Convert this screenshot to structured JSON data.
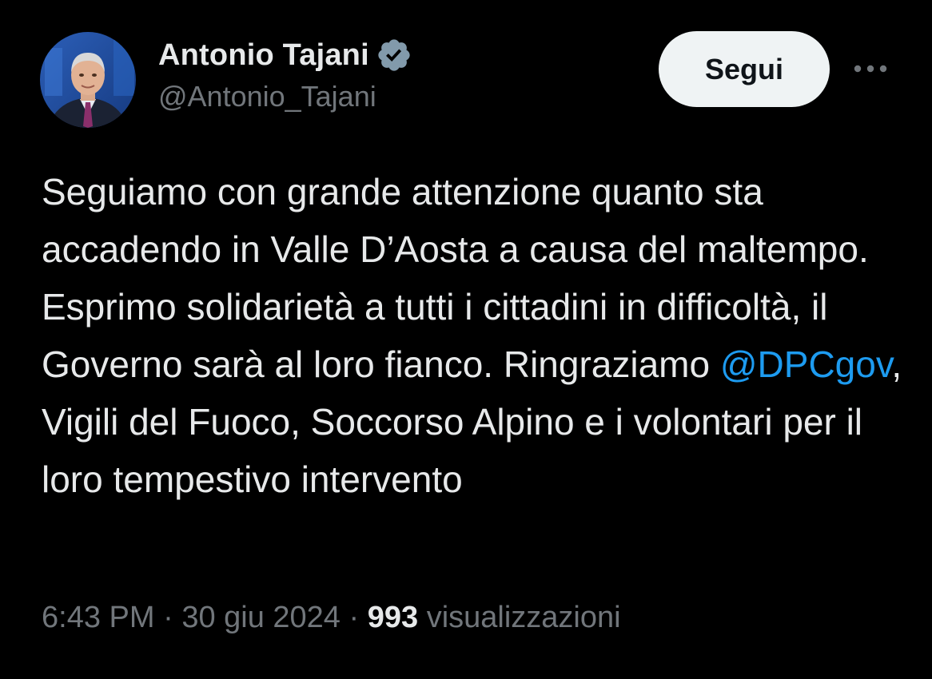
{
  "author": {
    "display_name": "Antonio Tajani",
    "handle": "@Antonio_Tajani",
    "verified_badge_icon": "verified-badge-icon"
  },
  "actions": {
    "follow_label": "Segui",
    "more_icon": "more-horizontal-icon"
  },
  "tweet": {
    "text_before_mention": "Seguiamo con grande attenzione quanto sta accadendo in Valle D’Aosta a causa del maltempo. Esprimo solidarietà a tutti i cittadini in difficoltà, il Governo sarà al loro fianco. Ringraziamo ",
    "mention": "@DPCgov",
    "text_after_mention": ", Vigili del Fuoco, Soccorso Alpino e i volontari per il loro tempestivo intervento"
  },
  "meta": {
    "time": "6:43 PM",
    "separator": " · ",
    "date": "30 giu 2024",
    "views_count": "993",
    "views_label": "visualizzazioni"
  },
  "colors": {
    "background": "#000000",
    "text_primary": "#e7e9ea",
    "text_secondary": "#71767b",
    "link": "#1d9bf0",
    "follow_button_bg": "#eff3f4",
    "verified_badge": "#829aab"
  }
}
